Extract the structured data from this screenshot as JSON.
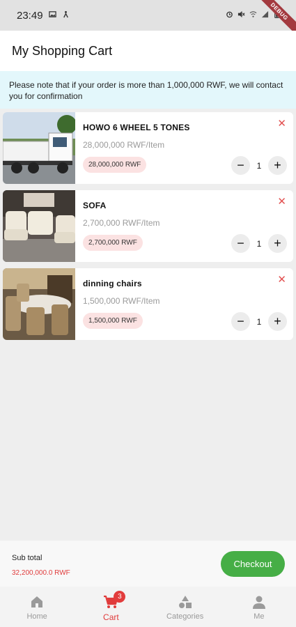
{
  "status_bar": {
    "time": "23:49"
  },
  "debug_banner": "DEBUG",
  "header": {
    "title": "My Shopping Cart"
  },
  "notice": {
    "text": "Please note that if your order is more than 1,000,000 RWF, we will contact you for confirmation"
  },
  "cart": {
    "items": [
      {
        "name": "HOWO 6 WHEEL 5 TONES",
        "unit_price": "28,000,000 RWF/Item",
        "total": "28,000,000 RWF",
        "quantity": "1",
        "image": "dump-truck-photo"
      },
      {
        "name": "SOFA",
        "unit_price": "2,700,000 RWF/Item",
        "total": "2,700,000 RWF",
        "quantity": "1",
        "image": "sofa-set-photo"
      },
      {
        "name": "dinning chairs",
        "unit_price": "1,500,000 RWF/Item",
        "total": "1,500,000 RWF",
        "quantity": "1",
        "image": "dining-set-photo"
      }
    ],
    "remove_symbol": "✕",
    "decrement_symbol": "−",
    "increment_symbol": "+"
  },
  "footer": {
    "subtotal_label": "Sub total",
    "subtotal_value": "32,200,000.0 RWF",
    "checkout_label": "Checkout"
  },
  "bottom_nav": {
    "items": [
      {
        "label": "Home",
        "icon": "home-icon",
        "active": false
      },
      {
        "label": "Cart",
        "icon": "cart-icon",
        "active": true,
        "badge": "3"
      },
      {
        "label": "Categories",
        "icon": "categories-icon",
        "active": false
      },
      {
        "label": "Me",
        "icon": "person-icon",
        "active": false
      }
    ]
  },
  "colors": {
    "accent": "#e03b3b",
    "checkout": "#46ae46",
    "notice_bg": "#e3f7fb",
    "badge_bg": "#fbe2e2"
  }
}
